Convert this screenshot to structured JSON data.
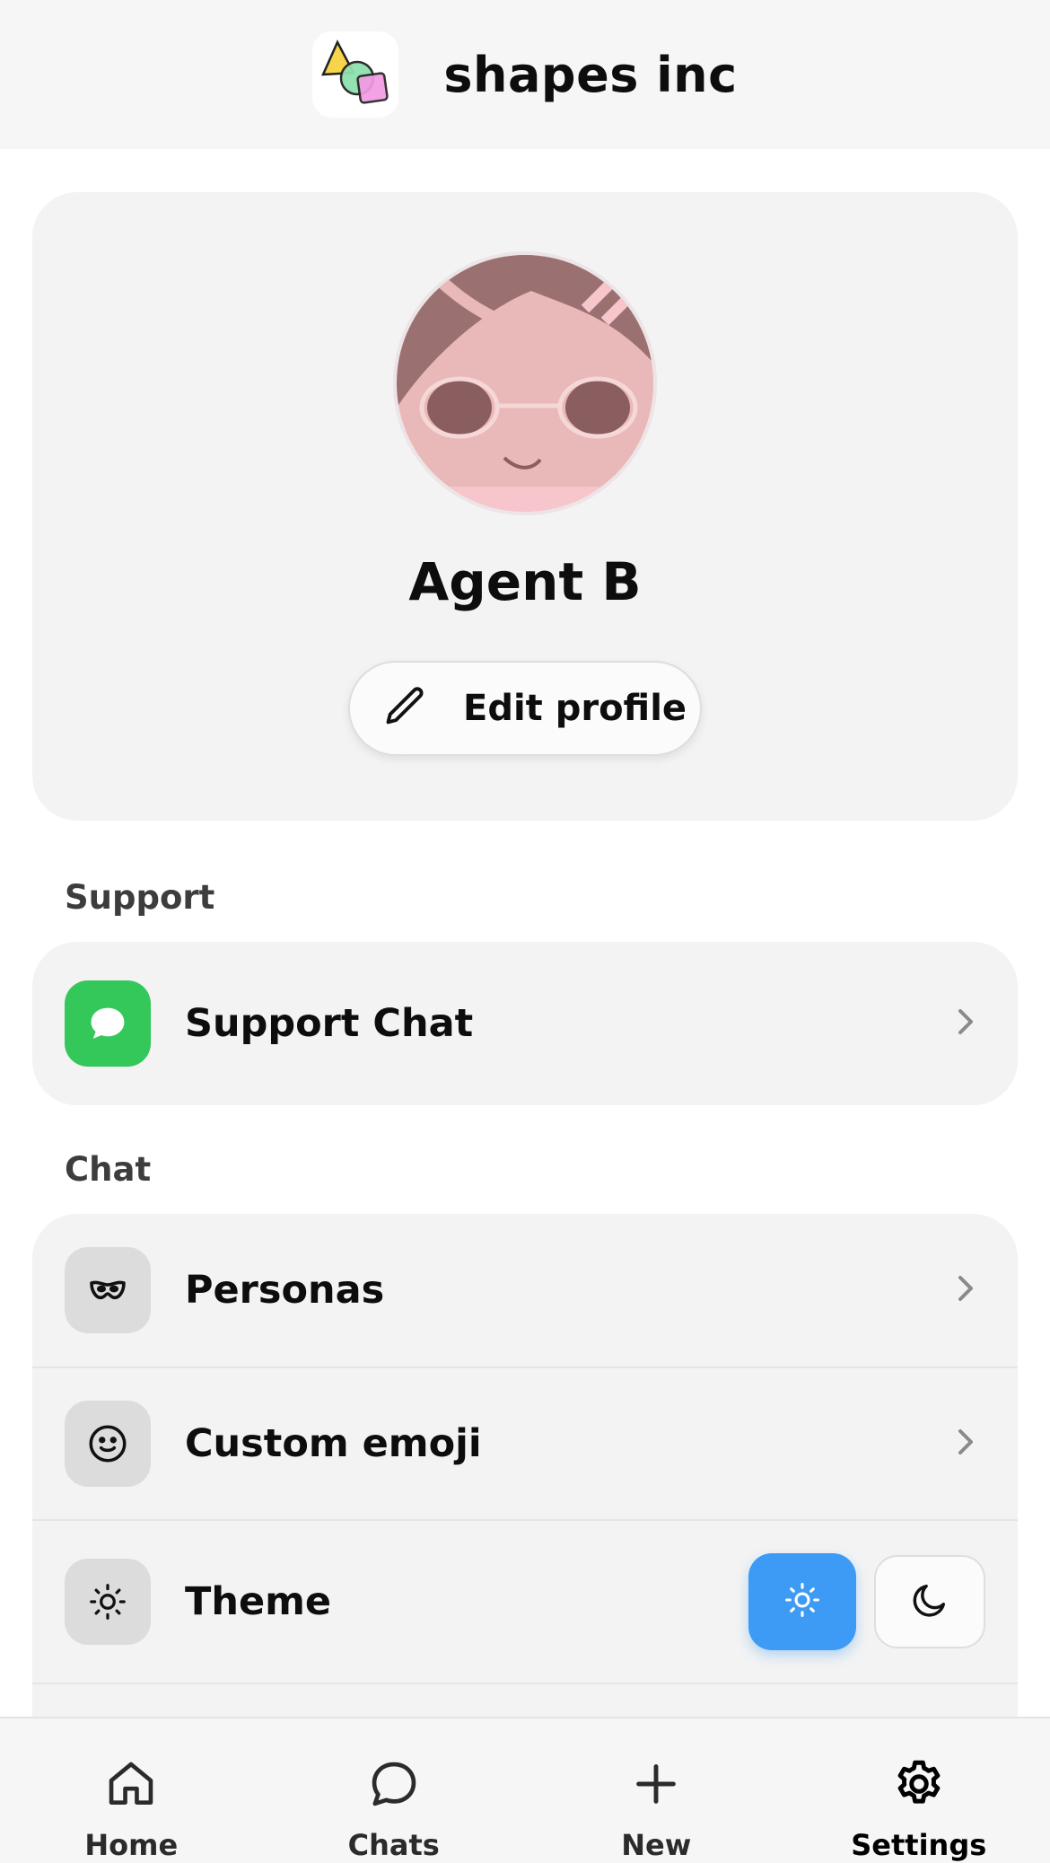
{
  "header": {
    "brand": "shapes inc",
    "logo_icon": "shapes-logo-icon"
  },
  "profile": {
    "name": "Agent B",
    "edit_label": "Edit profile",
    "avatar_icon": "avatar-image"
  },
  "sections": {
    "support": {
      "label": "Support",
      "items": [
        {
          "label": "Support Chat",
          "icon": "chat-bubble-icon",
          "icon_color": "#34c759"
        }
      ]
    },
    "chat": {
      "label": "Chat",
      "items": [
        {
          "label": "Personas",
          "icon": "mask-icon"
        },
        {
          "label": "Custom emoji",
          "icon": "smiley-icon"
        },
        {
          "label": "Theme",
          "icon": "sun-icon"
        }
      ]
    }
  },
  "theme": {
    "selected": "light",
    "accent": "#3d9bf5",
    "options": [
      "sun-icon",
      "moon-icon"
    ]
  },
  "tabs": [
    {
      "label": "Home",
      "icon": "home-icon"
    },
    {
      "label": "Chats",
      "icon": "chat-icon"
    },
    {
      "label": "New",
      "icon": "plus-icon"
    },
    {
      "label": "Settings",
      "icon": "gear-icon",
      "active": true
    }
  ]
}
